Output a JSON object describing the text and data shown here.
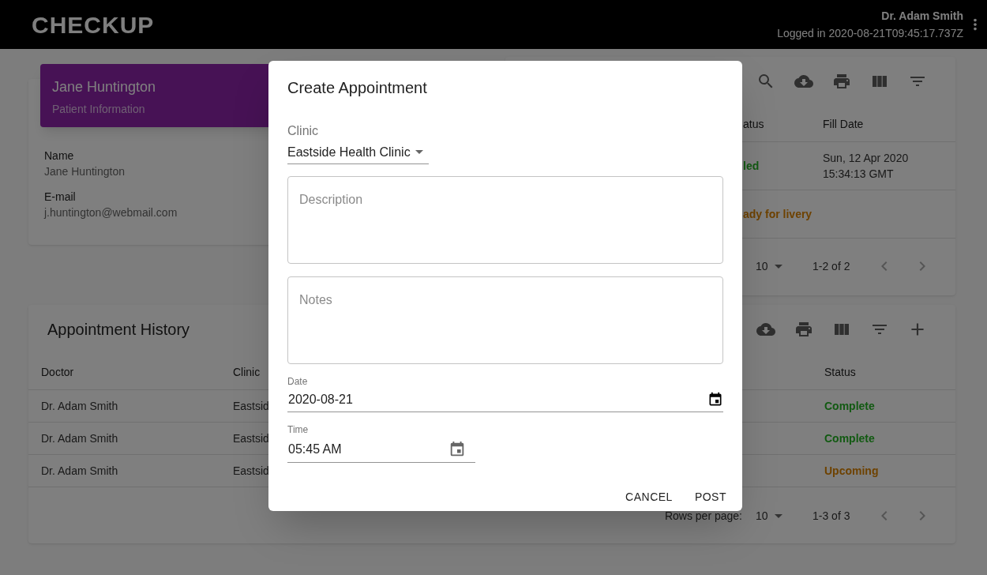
{
  "header": {
    "logo": "CHECKUP",
    "user_name": "Dr. Adam Smith",
    "login_info": "Logged in 2020-08-21T09:45:17.737Z"
  },
  "patient_card": {
    "name": "Jane Huntington",
    "subtitle": "Patient Information",
    "fields": [
      {
        "label": "Name",
        "value": "Jane Huntington"
      },
      {
        "label": "E-mail",
        "value": "j.huntington@webmail.com"
      }
    ]
  },
  "prescriptions": {
    "columns": [
      "atus",
      "Fill Date"
    ],
    "rows": [
      {
        "status": "led",
        "color": "#125a12",
        "fill_date": "Sun, 12 Apr 2020 15:34:13 GMT"
      },
      {
        "status": "ady for livery",
        "color": "#6e4200"
      }
    ],
    "pagination": {
      "rows_per_page": "10",
      "range": "1-2 of 2"
    }
  },
  "appointments": {
    "title": "Appointment History",
    "columns": [
      "Doctor",
      "Clinic",
      "Status"
    ],
    "rows": [
      {
        "doctor": "Dr. Adam Smith",
        "clinic": "Eastsid",
        "status": "Complete",
        "color": "#125a12"
      },
      {
        "doctor": "Dr. Adam Smith",
        "clinic": "Eastsid",
        "status": "Complete",
        "color": "#125a12"
      },
      {
        "doctor": "Dr. Adam Smith",
        "clinic": "Eastsid",
        "status": "Upcoming",
        "color": "#6e4200"
      }
    ],
    "pagination": {
      "label": "Rows per page:",
      "rows_per_page": "10",
      "range": "1-3 of 3"
    }
  },
  "dialog": {
    "title": "Create Appointment",
    "clinic": {
      "label": "Clinic",
      "value": "Eastside Health Clinic"
    },
    "description": {
      "placeholder": "Description"
    },
    "notes": {
      "placeholder": "Notes"
    },
    "date": {
      "label": "Date",
      "value": "2020-08-21"
    },
    "time": {
      "label": "Time",
      "value": "05:45 AM"
    },
    "buttons": [
      "CANCEL",
      "POST"
    ]
  }
}
